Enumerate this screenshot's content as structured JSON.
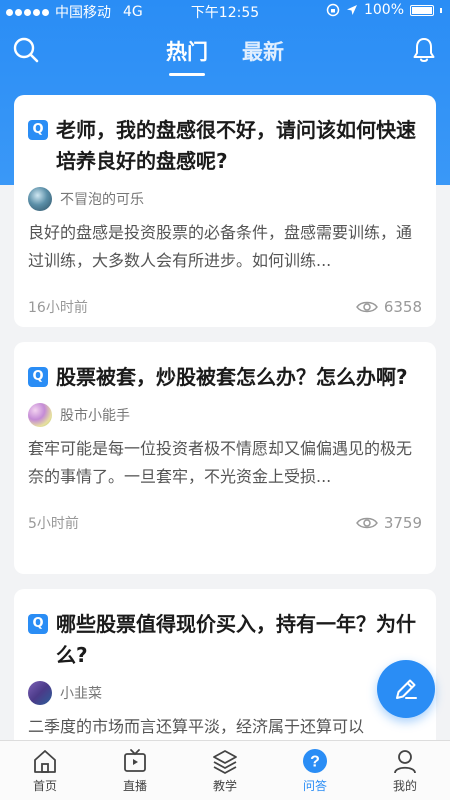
{
  "status_bar": {
    "carrier": "中国移动",
    "network": "4G",
    "time": "下午12:55",
    "battery": "100%"
  },
  "nav": {
    "tabs": [
      {
        "label": "热门",
        "active": true
      },
      {
        "label": "最新",
        "active": false
      }
    ],
    "left_icon": "search-icon",
    "right_icon": "bell-icon"
  },
  "questions": [
    {
      "badge": "Q",
      "title": "老师，我的盘感很不好，请问该如何快速培养良好的盘感呢?",
      "author": "不冒泡的可乐",
      "excerpt": "良好的盘感是投资股票的必备条件，盘感需要训练，通过训练，大多数人会有所进步。如何训练...",
      "time": "16小时前",
      "views": "6358"
    },
    {
      "badge": "Q",
      "title": "股票被套，炒股被套怎么办？怎么办啊?",
      "author": "股市小能手",
      "excerpt": "套牢可能是每一位投资者极不情愿却又偏偏遇见的极无奈的事情了。一旦套牢，不光资金上受损...",
      "time": "5小时前",
      "views": "3759"
    },
    {
      "badge": "Q",
      "title": "哪些股票值得现价买入，持有一年？为什么?",
      "author": "小韭菜",
      "excerpt": "二季度的市场而言还算平淡，经济属于还算可以",
      "time": "",
      "views": ""
    }
  ],
  "fab": {
    "icon": "edit-icon"
  },
  "tabbar": {
    "items": [
      {
        "label": "首页",
        "icon": "home-icon",
        "active": false
      },
      {
        "label": "直播",
        "icon": "tv-icon",
        "active": false
      },
      {
        "label": "教学",
        "icon": "layers-icon",
        "active": false
      },
      {
        "label": "问答",
        "icon": "question-icon",
        "active": true
      },
      {
        "label": "我的",
        "icon": "user-icon",
        "active": false
      }
    ]
  },
  "colors": {
    "accent": "#2a8df5",
    "background": "#f2f3f5",
    "tab_inactive": "#444444"
  }
}
